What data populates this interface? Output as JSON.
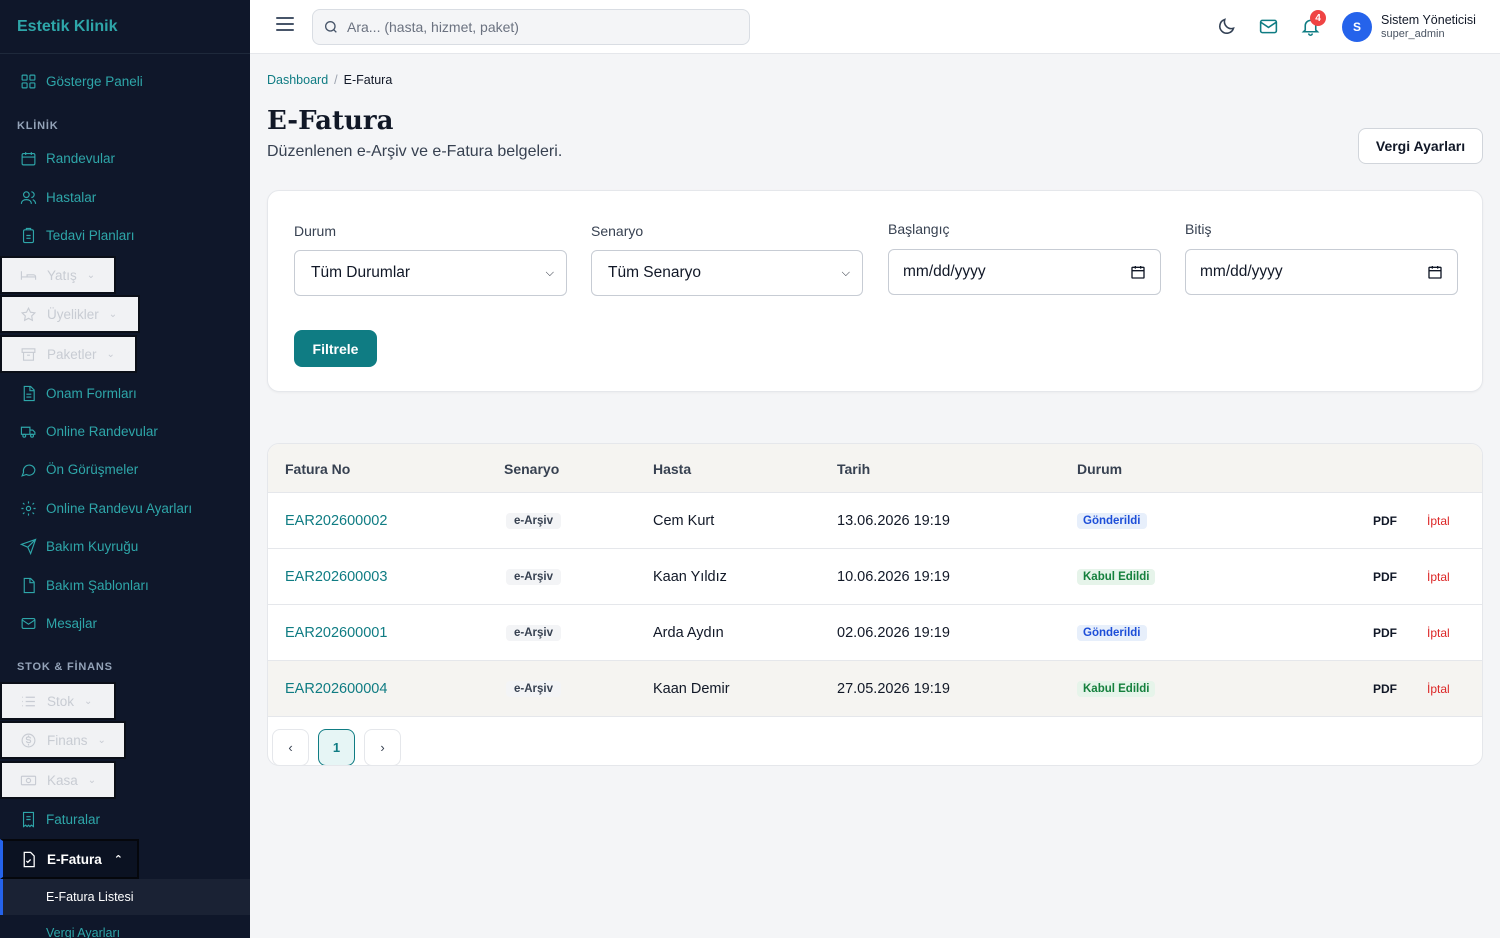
{
  "app": {
    "brand": "Estetik Klinik"
  },
  "sidebar": {
    "dashboard": "Gösterge Paneli",
    "section_clinic": "KLİNİK",
    "appointments": "Randevular",
    "patients": "Hastalar",
    "treatment_plans": "Tedavi Planları",
    "inpatient": "Yatış",
    "memberships": "Üyelikler",
    "packages": "Paketler",
    "consent_forms": "Onam Formları",
    "online_appointments": "Online Randevular",
    "pre_meetings": "Ön Görüşmeler",
    "online_settings": "Online Randevu Ayarları",
    "care_queue": "Bakım Kuyruğu",
    "care_templates": "Bakım Şablonları",
    "messages": "Mesajlar",
    "section_stock": "STOK & FİNANS",
    "stock": "Stok",
    "finance": "Finans",
    "cash": "Kasa",
    "invoices": "Faturalar",
    "einvoice": "E-Fatura",
    "einvoice_list": "E-Fatura Listesi",
    "tax_settings": "Vergi Ayarları"
  },
  "topbar": {
    "search_placeholder": "Ara... (hasta, hizmet, paket)",
    "notif_count": "4",
    "avatar_initial": "S",
    "user_name": "Sistem Yöneticisi",
    "user_role": "super_admin"
  },
  "breadcrumb": {
    "root": "Dashboard",
    "sep": "/",
    "current": "E-Fatura"
  },
  "page": {
    "title": "E-Fatura",
    "subtitle": "Düzenlenen e-Arşiv ve e-Fatura belgeleri.",
    "tax_button": "Vergi Ayarları"
  },
  "filters": {
    "status_label": "Durum",
    "status_value": "Tüm Durumlar",
    "scenario_label": "Senaryo",
    "scenario_value": "Tüm Senaryo",
    "start_label": "Başlangıç",
    "start_value": "mm/dd/yyyy",
    "end_label": "Bitiş",
    "end_value": "mm/dd/yyyy",
    "filter_button": "Filtrele"
  },
  "table": {
    "headers": [
      "Fatura No",
      "Senaryo",
      "Hasta",
      "Tarih",
      "Durum"
    ],
    "rows": [
      {
        "no": "EAR202600002",
        "scenario": "e-Arşiv",
        "patient": "Cem Kurt",
        "date": "13.06.2026 19:19",
        "status": "Gönderildi",
        "pdf": "PDF",
        "cancel": "İptal"
      },
      {
        "no": "EAR202600003",
        "scenario": "e-Arşiv",
        "patient": "Kaan Yıldız",
        "date": "10.06.2026 19:19",
        "status": "Kabul Edildi",
        "pdf": "PDF",
        "cancel": "İptal"
      },
      {
        "no": "EAR202600001",
        "scenario": "e-Arşiv",
        "patient": "Arda Aydın",
        "date": "02.06.2026 19:19",
        "status": "Gönderildi",
        "pdf": "PDF",
        "cancel": "İptal"
      },
      {
        "no": "EAR202600004",
        "scenario": "e-Arşiv",
        "patient": "Kaan Demir",
        "date": "27.05.2026 19:19",
        "status": "Kabul Edildi",
        "pdf": "PDF",
        "cancel": "İptal"
      }
    ]
  },
  "pagination": {
    "prev": "‹",
    "current": "1",
    "next": "›"
  },
  "colors": {
    "accent": "#0f7c83",
    "sidebar_bg": "#0f172a",
    "sidebar_text": "#2ea6a9",
    "danger": "#dc2626"
  }
}
